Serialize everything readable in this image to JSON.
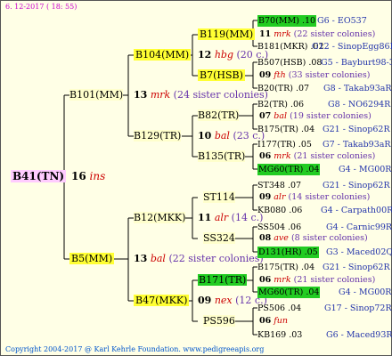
{
  "date": "6. 12-2017 ( 18: 55)",
  "footer": "Copyright 2004-2017 @ Karl Kehrle Foundation.   www.pedigreeapis.org",
  "root": {
    "id": "B41(TN)",
    "num": "16",
    "col": "ins"
  },
  "gen1": {
    "a": {
      "id": "B101(MM)",
      "num": "13",
      "col": "mrk",
      "sister": "(24 sister colonies)"
    },
    "b": {
      "id": "B5(MM)",
      "num": "13",
      "col": "bal",
      "sister": "(22 sister colonies)"
    }
  },
  "gen2": {
    "a": {
      "id": "B104(MM)",
      "num": "12",
      "col": "hbg",
      "sister": "(20 c.)"
    },
    "b": {
      "id": "B129(TR)",
      "num": "10",
      "col": "bal",
      "sister": "(23 c.)"
    },
    "c": {
      "id": "B12(MKK)",
      "num": "11",
      "col": "alr",
      "sister": "(14 c.)"
    },
    "d": {
      "id": "B47(MKK)",
      "num": "09",
      "col": "nex",
      "sister": "(12 c.)"
    }
  },
  "gen3": {
    "a": {
      "id": "B119(MM)",
      "num": "11",
      "col": "mrk",
      "sister": "(22 sister colonies)"
    },
    "b": {
      "id": "B7(HSB)",
      "num": "09",
      "col": "fth",
      "sister": "(33 sister colonies)"
    },
    "c": {
      "id": "B82(TR)",
      "num": "07",
      "col": "bal",
      "sister": "(19 sister colonies)"
    },
    "d": {
      "id": "B135(TR)",
      "num": "06",
      "col": "mrk",
      "sister": "(21 sister colonies)"
    },
    "e": {
      "id": "ST114",
      "num": "09",
      "col": "alr",
      "sister": "(14 sister colonies)"
    },
    "f": {
      "id": "SS324",
      "num": "08",
      "col": "ave",
      "sister": "(8 sister colonies)"
    },
    "g": {
      "id": "B171(TR)",
      "num": "06",
      "col": "mrk",
      "sister": "(21 sister colonies)"
    },
    "h": {
      "id": "PS596",
      "num": "06",
      "col": "fun",
      "sister": ""
    }
  },
  "gen4": [
    {
      "id": "B70(MM) .10",
      "ref": "G6 - EO537"
    },
    {
      "id": "B181(MKR) .02",
      "ref": "G12 - SinopEgg86R"
    },
    {
      "id": "B507(HSB) .08",
      "ref": "G5 - Bayburt98-3"
    },
    {
      "id": "B20(TR) .07",
      "ref": "G8 - Takab93aR"
    },
    {
      "id": "B2(TR) .06",
      "ref": "G8 - NO6294R"
    },
    {
      "id": "B175(TR) .04",
      "ref": "G21 - Sinop62R"
    },
    {
      "id": "I177(TR) .05",
      "ref": "G7 - Takab93aR"
    },
    {
      "id": "MG60(TR) .04",
      "ref": "G4 - MG00R"
    },
    {
      "id": "ST348 .07",
      "ref": "G21 - Sinop62R"
    },
    {
      "id": "KB080 .06",
      "ref": "G4 - Carpath00R"
    },
    {
      "id": "SS504 .06",
      "ref": "G4 - Carnic99R"
    },
    {
      "id": "D131(HR) .05",
      "ref": "G3 - Maced02Q"
    },
    {
      "id": "B175(TR) .04",
      "ref": "G21 - Sinop62R"
    },
    {
      "id": "MG60(TR) .04",
      "ref": "G4 - MG00R"
    },
    {
      "id": "PS506 .04",
      "ref": "G17 - Sinop72R"
    },
    {
      "id": "KB169 .03",
      "ref": "G6 - Maced93R"
    }
  ]
}
